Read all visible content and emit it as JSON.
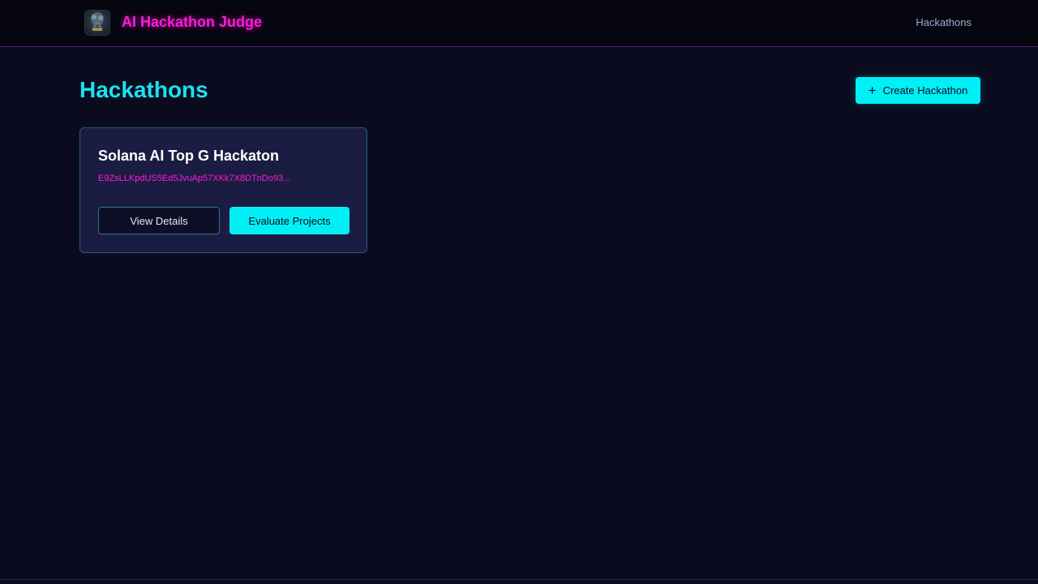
{
  "header": {
    "brand": "AI Hackathon Judge",
    "logo_icon": "robot-tree-logo",
    "nav": [
      {
        "label": "Hackathons"
      }
    ]
  },
  "main": {
    "title": "Hackathons",
    "create_button": {
      "icon": "plus-icon",
      "label": "Create Hackathon"
    },
    "cards": [
      {
        "title": "Solana AI Top G Hackaton",
        "address": "E9ZsLLKpdUS5Ed5JvuAp57XKk7X8DTnDo93...",
        "view_label": "View Details",
        "evaluate_label": "Evaluate Projects"
      }
    ]
  },
  "colors": {
    "background": "#0a0b1e",
    "accent_cyan": "#00f0f5",
    "accent_magenta": "#ff1ad9",
    "card": "#1b1c42"
  }
}
